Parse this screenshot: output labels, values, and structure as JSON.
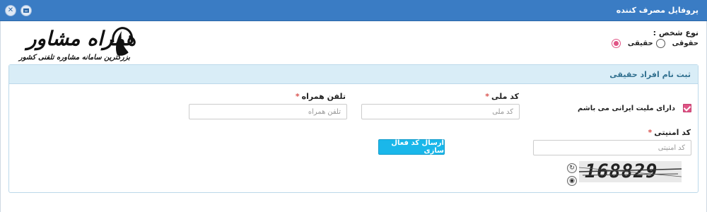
{
  "window": {
    "title": "پروفایل مصرف کننده",
    "close_glyph": "✕"
  },
  "person_type": {
    "label": "نوع شخص :",
    "options": [
      {
        "label": "حقیقی",
        "checked": true
      },
      {
        "label": "حقوقی",
        "checked": false
      }
    ]
  },
  "logo": {
    "brand": "همراه مشاور",
    "tagline": "بزرگترین سامانه مشاوره تلفنی کشور"
  },
  "panel": {
    "title": "ثبت نام افراد حقیقی",
    "iranian_citizen": {
      "label": "دارای ملیت ایرانی می باشم",
      "checked": true
    },
    "national_code": {
      "label": "کد ملی",
      "required_mark": "*",
      "placeholder": "کد ملی",
      "value": ""
    },
    "mobile": {
      "label": "تلفن همراه",
      "required_mark": "*",
      "placeholder": "تلفن همراه",
      "value": ""
    },
    "security_code": {
      "label": "کد امنیتی",
      "required_mark": "*",
      "placeholder": "کد امنیتی",
      "value": ""
    },
    "send_button": "ارسال کد فعال سازی",
    "captcha": {
      "text": "168829",
      "refresh_glyph": "↻",
      "audio_glyph": "◉"
    }
  },
  "colors": {
    "titlebar": "#3a7cc4",
    "panel_header": "#d9edf7",
    "accent_pink": "#e05586",
    "button_cyan": "#1ab7ea",
    "required_red": "#d9534f"
  }
}
